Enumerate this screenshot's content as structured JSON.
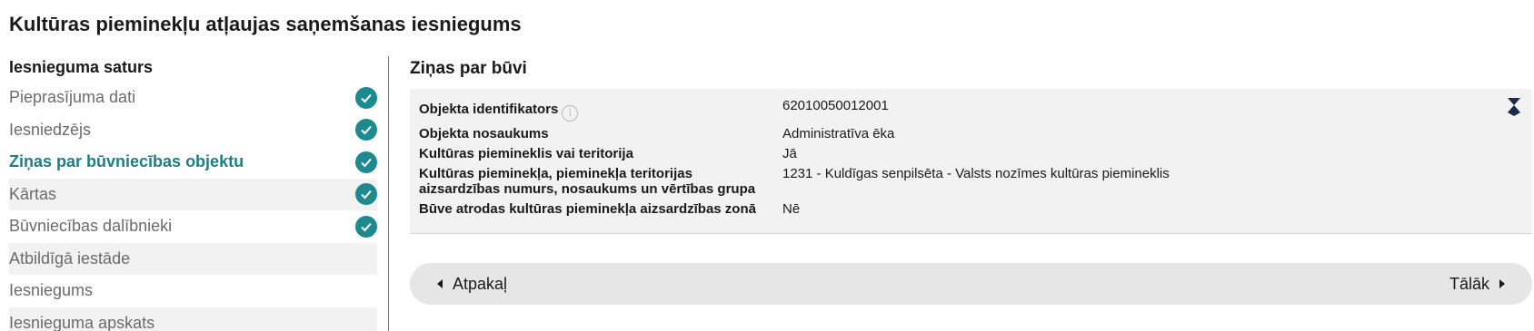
{
  "page": {
    "title": "Kultūras pieminekļu atļaujas saņemšanas iesniegums"
  },
  "sidebar": {
    "heading": "Iesnieguma saturs",
    "items": [
      {
        "label": "Pieprasījuma dati",
        "completed": true,
        "active": false
      },
      {
        "label": "Iesniedzējs",
        "completed": true,
        "active": false
      },
      {
        "label": "Ziņas par būvniecības objektu",
        "completed": true,
        "active": true
      },
      {
        "label": "Kārtas",
        "completed": true,
        "active": false
      },
      {
        "label": "Būvniecības dalībnieki",
        "completed": true,
        "active": false
      },
      {
        "label": "Atbildīgā iestāde",
        "completed": false,
        "active": false
      },
      {
        "label": "Iesniegums",
        "completed": false,
        "active": false
      },
      {
        "label": "Iesnieguma apskats",
        "completed": false,
        "active": false
      }
    ]
  },
  "main": {
    "section_title": "Ziņas par būvi",
    "fields": [
      {
        "label": "Objekta identifikators",
        "value": "62010050012001",
        "has_info_icon": true
      },
      {
        "label": "Objekta nosaukums",
        "value": "Administratīva ēka"
      },
      {
        "label": "Kultūras piemineklis vai teritorija",
        "value": "Jā"
      },
      {
        "label": "Kultūras pieminekļa, pieminekļa teritorijas aizsardzības numurs, nosaukums un vērtības grupa",
        "value": "1231 - Kuldīgas senpilsēta - Valsts nozīmes kultūras piemineklis"
      },
      {
        "label": "Būve atrodas kultūras pieminekļa aizsardzības zonā",
        "value": "Nē"
      }
    ],
    "info_icon_glyph": "i"
  },
  "nav": {
    "back_label": "Atpakaļ",
    "next_label": "Tālāk"
  },
  "colors": {
    "accent": "#1d8a8f",
    "active_text": "#1a7f86",
    "collapse_icon": "#1c2b4a"
  }
}
